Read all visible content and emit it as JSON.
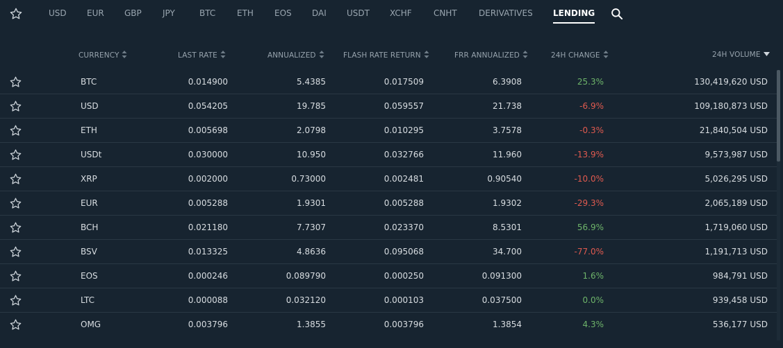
{
  "nav": {
    "tabs": [
      "USD",
      "EUR",
      "GBP",
      "JPY",
      "BTC",
      "ETH",
      "EOS",
      "DAI",
      "USDT",
      "XCHF",
      "CNHT",
      "DERIVATIVES",
      "LENDING"
    ],
    "active_tab": "LENDING",
    "icons": [
      "star-icon",
      "search-icon"
    ]
  },
  "table": {
    "columns": [
      "CURRENCY",
      "LAST RATE",
      "ANNUALIZED",
      "FLASH RATE RETURN",
      "FRR ANNUALIZED",
      "24H CHANGE",
      "24H VOLUME"
    ],
    "sorted_column": "24H VOLUME",
    "sort_direction": "descending",
    "rows": [
      {
        "currency": "BTC",
        "last_rate": "0.014900",
        "annualized": "5.4385",
        "frr": "0.017509",
        "frr_annualized": "6.3908",
        "change": "25.3%",
        "volume": "130,419,620 USD"
      },
      {
        "currency": "USD",
        "last_rate": "0.054205",
        "annualized": "19.785",
        "frr": "0.059557",
        "frr_annualized": "21.738",
        "change": "-6.9%",
        "volume": "109,180,873 USD"
      },
      {
        "currency": "ETH",
        "last_rate": "0.005698",
        "annualized": "2.0798",
        "frr": "0.010295",
        "frr_annualized": "3.7578",
        "change": "-0.3%",
        "volume": "21,840,504 USD"
      },
      {
        "currency": "USDt",
        "last_rate": "0.030000",
        "annualized": "10.950",
        "frr": "0.032766",
        "frr_annualized": "11.960",
        "change": "-13.9%",
        "volume": "9,573,987 USD"
      },
      {
        "currency": "XRP",
        "last_rate": "0.002000",
        "annualized": "0.73000",
        "frr": "0.002481",
        "frr_annualized": "0.90540",
        "change": "-10.0%",
        "volume": "5,026,295 USD"
      },
      {
        "currency": "EUR",
        "last_rate": "0.005288",
        "annualized": "1.9301",
        "frr": "0.005288",
        "frr_annualized": "1.9302",
        "change": "-29.3%",
        "volume": "2,065,189 USD"
      },
      {
        "currency": "BCH",
        "last_rate": "0.021180",
        "annualized": "7.7307",
        "frr": "0.023370",
        "frr_annualized": "8.5301",
        "change": "56.9%",
        "volume": "1,719,060 USD"
      },
      {
        "currency": "BSV",
        "last_rate": "0.013325",
        "annualized": "4.8636",
        "frr": "0.095068",
        "frr_annualized": "34.700",
        "change": "-77.0%",
        "volume": "1,191,713 USD"
      },
      {
        "currency": "EOS",
        "last_rate": "0.000246",
        "annualized": "0.089790",
        "frr": "0.000250",
        "frr_annualized": "0.091300",
        "change": "1.6%",
        "volume": "984,791 USD"
      },
      {
        "currency": "LTC",
        "last_rate": "0.000088",
        "annualized": "0.032120",
        "frr": "0.000103",
        "frr_annualized": "0.037500",
        "change": "0.0%",
        "volume": "939,458 USD"
      },
      {
        "currency": "OMG",
        "last_rate": "0.003796",
        "annualized": "1.3855",
        "frr": "0.003796",
        "frr_annualized": "1.3854",
        "change": "4.3%",
        "volume": "536,177 USD"
      }
    ]
  },
  "colors": {
    "background": "#172430",
    "positive": "#6eb46a",
    "negative": "#e05a4f",
    "divider": "#2a3844"
  }
}
